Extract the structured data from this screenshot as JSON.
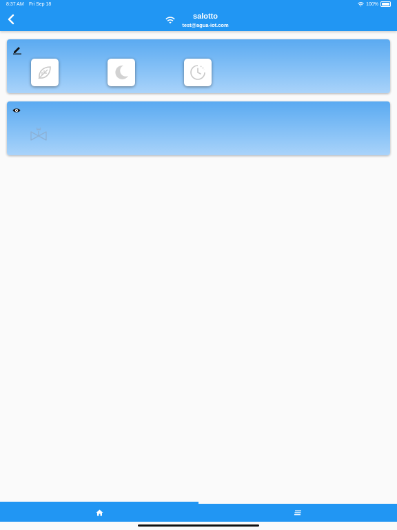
{
  "status_bar": {
    "time": "8:37 AM",
    "date": "Fri Sep 18",
    "battery": "100%"
  },
  "header": {
    "title": "salotto",
    "subtitle": "test@agua-iot.com",
    "back_icon": "chevron-left-icon",
    "connection_icon": "wifi-icon"
  },
  "modes_card": {
    "header_icon": "pencil-icon",
    "buttons": [
      {
        "name": "eco",
        "icon": "leaf-icon"
      },
      {
        "name": "night",
        "icon": "moon-icon"
      },
      {
        "name": "timer",
        "icon": "clock-icon"
      }
    ]
  },
  "view_card": {
    "header_icon": "eye-icon",
    "device_icon": "valve-icon"
  },
  "bottom_nav": {
    "active_tab": "home",
    "tabs": [
      {
        "name": "home",
        "icon": "home-icon"
      },
      {
        "name": "menu",
        "icon": "menu-icon"
      }
    ]
  },
  "colors": {
    "primary": "#2196f3",
    "card_top": "#5aaaf1",
    "card_bottom": "#a9d3fa",
    "background": "#fafafa"
  }
}
